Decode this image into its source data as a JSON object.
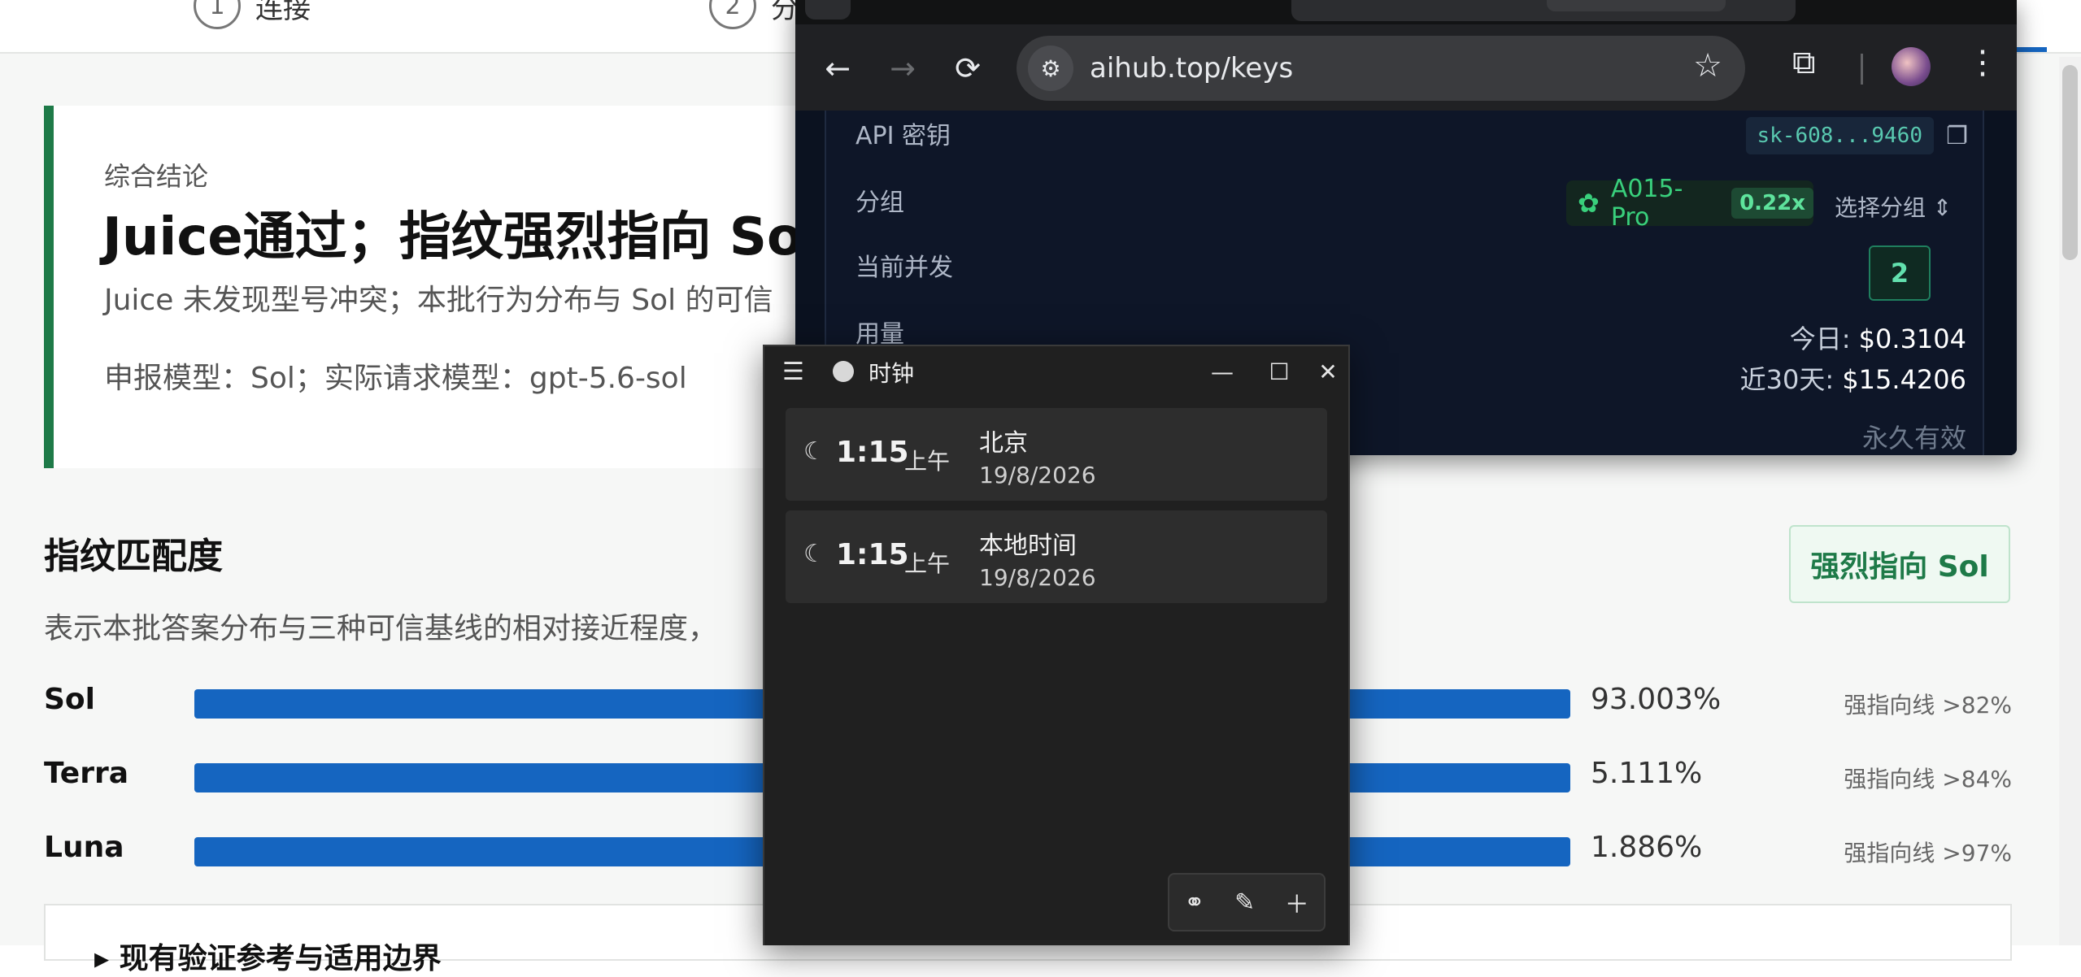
{
  "steps": [
    {
      "num": "1",
      "label": "连接"
    },
    {
      "num": "2",
      "label": "分"
    }
  ],
  "conclusion": {
    "label": "综合结论",
    "title": "Juice通过；指纹强烈指向 Sol",
    "desc": "Juice 未发现型号冲突；本批行为分布与 Sol 的可信",
    "model": "申报模型：Sol；实际请求模型：gpt-5.6-sol"
  },
  "fingerprint": {
    "title": "指纹匹配度",
    "badge": "强烈指向 Sol",
    "desc": "表示本批答案分布与三种可信基线的相对接近程度，",
    "rows": [
      {
        "name": "Sol",
        "pct": "93.003%",
        "threshold": "强指向线 >82%"
      },
      {
        "name": "Terra",
        "pct": "5.111%",
        "threshold": "强指向线 >84%"
      },
      {
        "name": "Luna",
        "pct": "1.886%",
        "threshold": "强指向线 >97%"
      }
    ]
  },
  "bottom_card": {
    "title": "▸ 现有验证参考与适用边界"
  },
  "browser": {
    "url": "aihub.top/keys",
    "api_key_label": "API 密钥",
    "api_key_value": "sk-608...9460",
    "group_label": "分组",
    "group_name": "A015-Pro",
    "group_multiplier": "0.22x",
    "group_select": "选择分组",
    "concurrency_label": "当前并发",
    "concurrency_value": "2",
    "usage_label": "用量",
    "usage_today_label": "今日:",
    "usage_today_value": "$0.3104",
    "usage_30d_label": "近30天:",
    "usage_30d_value": "$15.4206",
    "validity": "永久有效"
  },
  "clock": {
    "title": "时钟",
    "cards": [
      {
        "time": "1:15",
        "ampm": "上午",
        "city": "北京",
        "date": "19/8/2026"
      },
      {
        "time": "1:15",
        "ampm": "上午",
        "city": "本地时间",
        "date": "19/8/2026"
      }
    ]
  }
}
